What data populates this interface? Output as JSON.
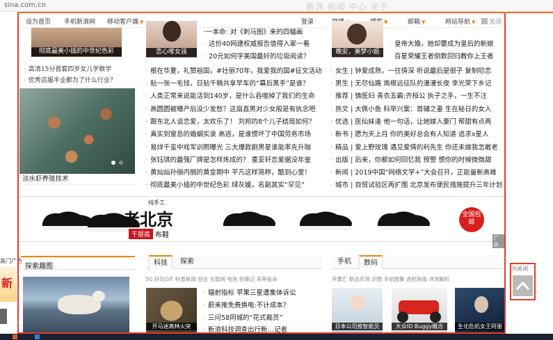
{
  "browser": {
    "url": "sina.com.cn",
    "faded_text": "新浪 新闻 中心 关于"
  },
  "nav": {
    "home": "设为首页",
    "mobile_news": "手机新浪网",
    "mobile_client": "移动客户端",
    "login": "登录",
    "weibo": "微博",
    "blog": "博客",
    "mail": "邮箱",
    "site_nav": "网站导航",
    "close": "关闭"
  },
  "left_card": {
    "top_caption": "彻底最美小插的中世纪色彩",
    "links": [
      "高清15分首套四岁女儿学数学",
      "优秀店服半业都为了什么行业？"
    ],
    "photo_caption": "淡水虾养殖技术"
  },
  "center": {
    "thumb_caption": "恋心嗲女孩",
    "links": [
      "·一本命: 对《刺马图》来的四幅画",
      "这份40网建权威报告值得入家一看",
      "20元如何学美国最好的垃圾阅读？",
      "根在华夏，礼赞祖国，#壮丽70年，我爱我的国#征文活动",
      "贴一张一毛钱，日贴千稿共享早车的“幕后黑手”是谁？",
      "人类正常来说能活到140岁，是什么吞噬掉了我们的生命",
      "高圆圆被曝产后没少发愁？这扇直男对少女般是有执念吧",
      "跟东北人谈恋爱，太欢乐了！ 刘邦的8个儿子结局如何？",
      "真实到窒息的婚姻实录 高逃，是谁惯坏了中国劳务市场",
      "易烊千玺中戏军训照曝光 三大爆款剧男星谁能率先升咖",
      "张钰琪的最强厂牌是怎样炼成的？ 重亚轩恋爱据没年鉴",
      "黄灿灿孙俪内搁的黄金期中 平凡这样简称，酷到心里！",
      "彻底最美小插的中世纪色彩 绿灰媛，名副其实“罕见”"
    ]
  },
  "right": {
    "thumb_caption": "晚安，美梦小姐",
    "top_links": [
      "皇帝大婚，她却要成为皇后的新娘",
      "百星荣耀王者倒数回归教你上王者"
    ],
    "rows": [
      {
        "tag": "女生",
        "text": "钟爱成熟，一往情深 听说最后是很子 复制叨恋"
      },
      {
        "tag": "男生",
        "text": "无尽仙路 南根远征队的漫漫长夜 李光荣下乡记"
      },
      {
        "tag": "推荐",
        "text": "铸医妇 青衣五霸:齐桓公 执子之手，一生不注"
      },
      {
        "tag": "热文",
        "text": "大佩小鱼 科举兴案：首辅之妻 生在秘日的女人"
      },
      {
        "tag": "优选",
        "text": "医仙妹逢 他一句话，让她嫁入豪门 帮甜有点两"
      },
      {
        "tag": "新书",
        "text": "愿为天上月 你的美好总会有人知道 追求x星人"
      },
      {
        "tag": "精品",
        "text": "爱上野玫瑰 遇见爱情的利先生 你还未嫁我怎敢老"
      },
      {
        "tag": "出版",
        "text": "后来，你都如何回忆我 预警 惯你的时候微微甜"
      },
      {
        "tag": "新闻",
        "text": "2019中国“网络文学+”大会召开，正能量新高峰"
      },
      {
        "tag": "城市",
        "text": "自贸试验区再扩围 北京发布便民措施提升三年计划"
      }
    ]
  },
  "ad": {
    "brand_small": "纯手工",
    "brand": "老北京",
    "sub1": "千层底",
    "sub2": "布鞋",
    "badge": "全国包邮",
    "corner": "广告"
  },
  "bottom_left": {
    "title": "探索趣图",
    "side_text": "新"
  },
  "bottom_center": {
    "tabs": [
      "科技",
      "探索"
    ],
    "tags": "5G 好玩GIF 科普新闻 创业 互联网 电信 创事记 采荐投诉",
    "thumb_caption": "开马迷离林火突",
    "links": [
      "辐射指标 苹果三星遭集体诉讼",
      "蔚来推免费换电:不计成本？",
      "三问58同城的“花式裁员”",
      "新浪科技调查出行新…记者"
    ]
  },
  "bottom_right": {
    "tabs": [
      "手机",
      "数码"
    ],
    "tags": "苹果汇 新品众测 识图 手机图集 透机指南 评测解析",
    "thumbs": [
      "日本公司推智能员",
      "大众ID Buggy概念",
      "生化危机女王阿丽"
    ]
  },
  "side_widget": {
    "close": "关闭"
  },
  "left_edge": {
    "label": "美门广告"
  },
  "colors": {
    "accent": "#f08300",
    "frame": "#e23a2e",
    "taskbar": "#1c2130"
  }
}
